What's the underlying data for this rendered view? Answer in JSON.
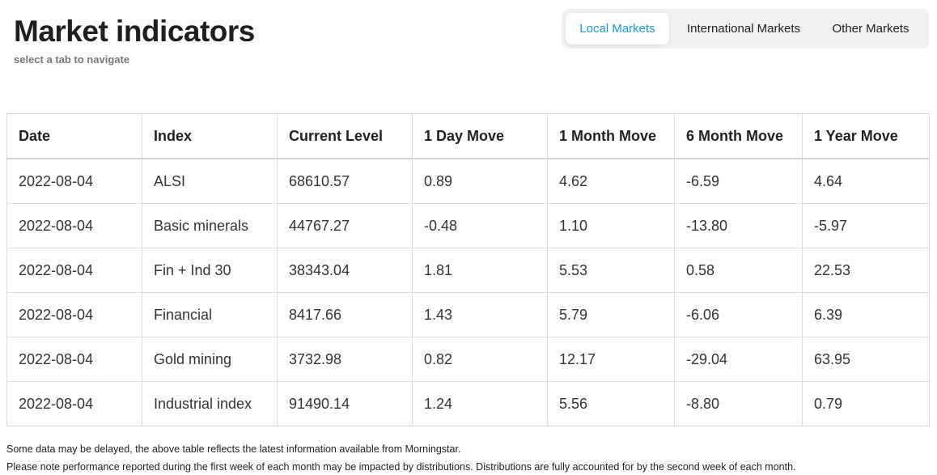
{
  "header": {
    "title": "Market indicators",
    "subtitle": "select a tab to navigate"
  },
  "tabs": [
    {
      "label": "Local Markets",
      "active": true
    },
    {
      "label": "International Markets",
      "active": false
    },
    {
      "label": "Other Markets",
      "active": false
    }
  ],
  "table": {
    "columns": [
      "Date",
      "Index",
      "Current Level",
      "1 Day Move",
      "1 Month Move",
      "6 Month Move",
      "1 Year Move"
    ],
    "rows": [
      [
        "2022-08-04",
        "ALSI",
        "68610.57",
        "0.89",
        "4.62",
        "-6.59",
        "4.64"
      ],
      [
        "2022-08-04",
        "Basic minerals",
        "44767.27",
        "-0.48",
        "1.10",
        "-13.80",
        "-5.97"
      ],
      [
        "2022-08-04",
        "Fin + Ind 30",
        "38343.04",
        "1.81",
        "5.53",
        "0.58",
        "22.53"
      ],
      [
        "2022-08-04",
        "Financial",
        "8417.66",
        "1.43",
        "5.79",
        "-6.06",
        "6.39"
      ],
      [
        "2022-08-04",
        "Gold mining",
        "3732.98",
        "0.82",
        "12.17",
        "-29.04",
        "63.95"
      ],
      [
        "2022-08-04",
        "Industrial index",
        "91490.14",
        "1.24",
        "5.56",
        "-8.80",
        "0.79"
      ]
    ]
  },
  "footnotes": [
    "Some data may be delayed, the above table reflects the latest information available from Morningstar.",
    "Please note performance reported during the first week of each month may be impacted by distributions. Distributions are fully accounted for by the second week of each month."
  ],
  "colors": {
    "accent": "#1a9ad6",
    "tab_bar_bg": "#f1f1f1",
    "border": "#dcdcdc"
  }
}
